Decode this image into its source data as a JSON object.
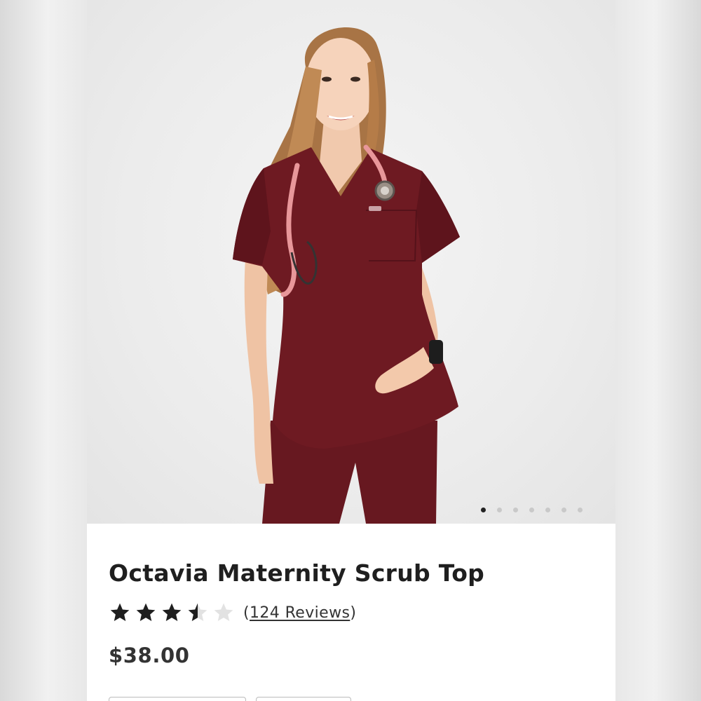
{
  "product": {
    "image_alt": "Model wearing burgundy maternity scrub top with pink stethoscope",
    "gallery": {
      "count": 7,
      "active_index": 0
    },
    "title": "Octavia Maternity Scrub Top",
    "rating": {
      "value": 3.5,
      "max": 5,
      "open_paren": "(",
      "reviews_label": "124 Reviews",
      "close_paren": ")"
    },
    "price": "$38.00",
    "colors": {
      "star": "#1f1f1f",
      "star_empty": "#e2e2e2",
      "scrub": "#6e1a22"
    }
  }
}
